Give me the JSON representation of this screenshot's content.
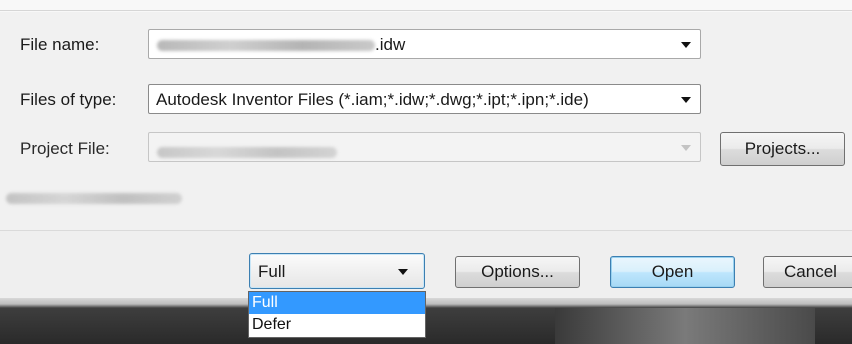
{
  "dialog": {
    "file_name": {
      "label": "File name:",
      "value_suffix": ".idw"
    },
    "files_of_type": {
      "label": "Files of type:",
      "value": "Autodesk Inventor Files (*.iam;*.idw;*.dwg;*.ipt;*.ipn;*.ide)"
    },
    "project_file": {
      "label": "Project File:"
    },
    "projects_button": "Projects...",
    "load_mode": {
      "selected": "Full",
      "options": [
        "Full",
        "Defer"
      ]
    },
    "options_button": "Options...",
    "open_button": "Open",
    "cancel_button": "Cancel"
  }
}
